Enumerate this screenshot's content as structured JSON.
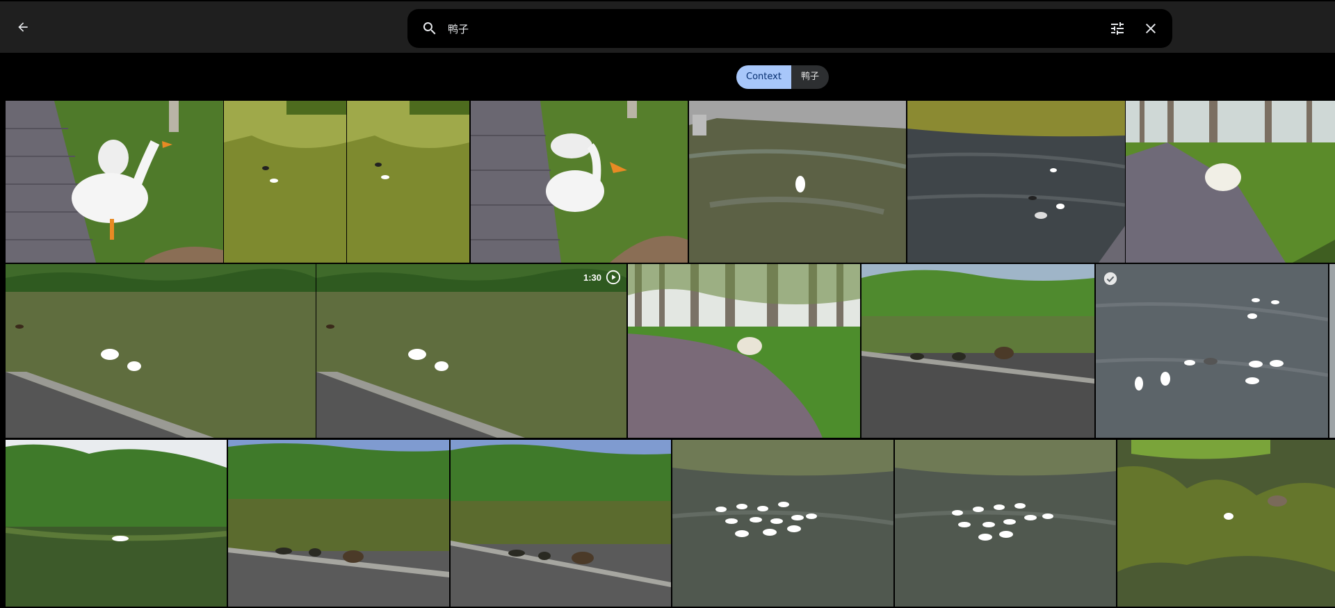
{
  "search": {
    "query": "鸭子"
  },
  "chips": [
    {
      "label": "Context",
      "active": true
    },
    {
      "label": "鸭子",
      "active": false
    }
  ],
  "video_badge": {
    "duration": "1:30"
  },
  "icons": {
    "back": "arrow-left-icon",
    "search": "search-icon",
    "filter": "tune-icon",
    "close": "close-icon",
    "play": "play-circle-icon",
    "check": "check-circle-icon"
  },
  "colors": {
    "topbar": "#1f1f1f",
    "chip_active": "#a8c7fa",
    "chip_inactive": "#2d2f31"
  }
}
